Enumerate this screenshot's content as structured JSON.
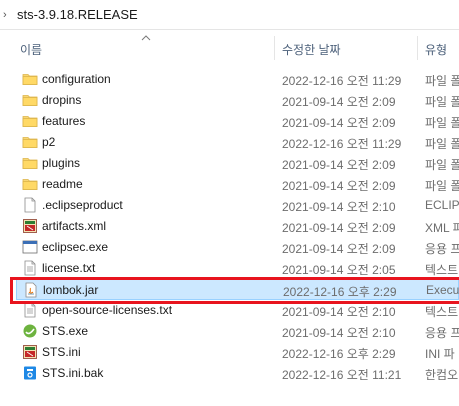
{
  "address": {
    "path": "sts-3.9.18.RELEASE"
  },
  "columns": {
    "name": "이름",
    "date_modified": "수정한 날짜",
    "type": "유형"
  },
  "files": [
    {
      "name": "configuration",
      "date": "2022-12-16 오전 11:29",
      "type": "파일 폴",
      "icon": "folder-icon"
    },
    {
      "name": "dropins",
      "date": "2021-09-14 오전 2:09",
      "type": "파일 폴",
      "icon": "folder-icon"
    },
    {
      "name": "features",
      "date": "2021-09-14 오전 2:09",
      "type": "파일 폴",
      "icon": "folder-icon"
    },
    {
      "name": "p2",
      "date": "2022-12-16 오전 11:29",
      "type": "파일 폴",
      "icon": "folder-icon"
    },
    {
      "name": "plugins",
      "date": "2021-09-14 오전 2:09",
      "type": "파일 폴",
      "icon": "folder-icon"
    },
    {
      "name": "readme",
      "date": "2021-09-14 오전 2:09",
      "type": "파일 폴",
      "icon": "folder-icon"
    },
    {
      "name": ".eclipseproduct",
      "date": "2021-09-14 오전 2:10",
      "type": "ECLIPS",
      "icon": "blank-file-icon"
    },
    {
      "name": "artifacts.xml",
      "date": "2021-09-14 오전 2:09",
      "type": "XML 파",
      "icon": "xml-file-icon"
    },
    {
      "name": "eclipsec.exe",
      "date": "2021-09-14 오전 2:09",
      "type": "응용 프",
      "icon": "exe-file-icon"
    },
    {
      "name": "license.txt",
      "date": "2021-09-14 오전 2:05",
      "type": "텍스트",
      "icon": "text-file-icon"
    },
    {
      "name": "lombok.jar",
      "date": "2022-12-16 오후 2:29",
      "type": "Execut",
      "icon": "jar-file-icon"
    },
    {
      "name": "open-source-licenses.txt",
      "date": "2021-09-14 오전 2:10",
      "type": "텍스트",
      "icon": "text-file-icon"
    },
    {
      "name": "STS.exe",
      "date": "2021-09-14 오전 2:10",
      "type": "응용 프",
      "icon": "sts-app-icon"
    },
    {
      "name": "STS.ini",
      "date": "2022-12-16 오후 2:29",
      "type": "INI 파",
      "icon": "ini-file-icon"
    },
    {
      "name": "STS.ini.bak",
      "date": "2022-12-16 오전 11:21",
      "type": "한컴오",
      "icon": "hwp-file-icon"
    }
  ],
  "selected_file": "lombok.jar",
  "colors": {
    "selection_bg": "#cce8ff",
    "highlight_border": "#e8141e",
    "folder": "#f8d775"
  }
}
